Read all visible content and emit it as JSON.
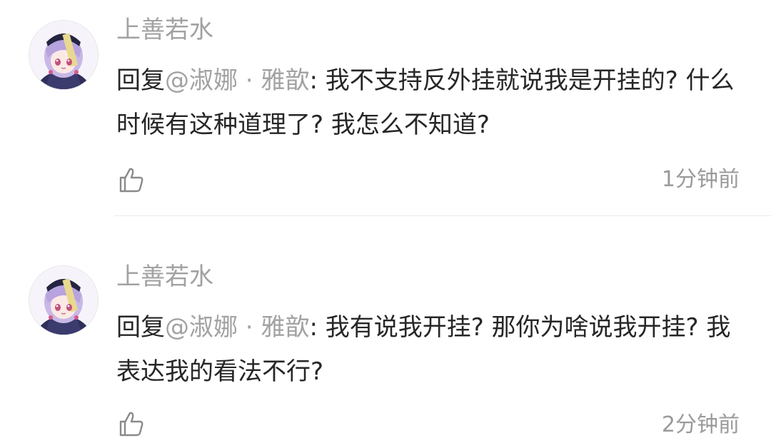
{
  "comments": [
    {
      "username": "上善若水",
      "reply_prefix": "回复",
      "mention": "@淑娜 · 雅歆",
      "colon": ": ",
      "text": "我不支持反外挂就说我是开挂的? 什么时候有这种道理了? 我怎么不知道?",
      "time": "1分钟前",
      "avatar_icon": "avatar-anime-girl-icon",
      "like_icon": "thumbs-up-icon"
    },
    {
      "username": "上善若水",
      "reply_prefix": "回复",
      "mention": "@淑娜 · 雅歆",
      "colon": ": ",
      "text": "我有说我开挂? 那你为啥说我开挂? 我表达我的看法不行?",
      "time": "2分钟前",
      "avatar_icon": "avatar-anime-girl-icon",
      "like_icon": "thumbs-up-icon"
    }
  ],
  "colors": {
    "username": "#a2a2a2",
    "body_text": "#262626",
    "mention": "#a2a2a2",
    "time": "#9a9a9a",
    "divider": "#ececec"
  }
}
